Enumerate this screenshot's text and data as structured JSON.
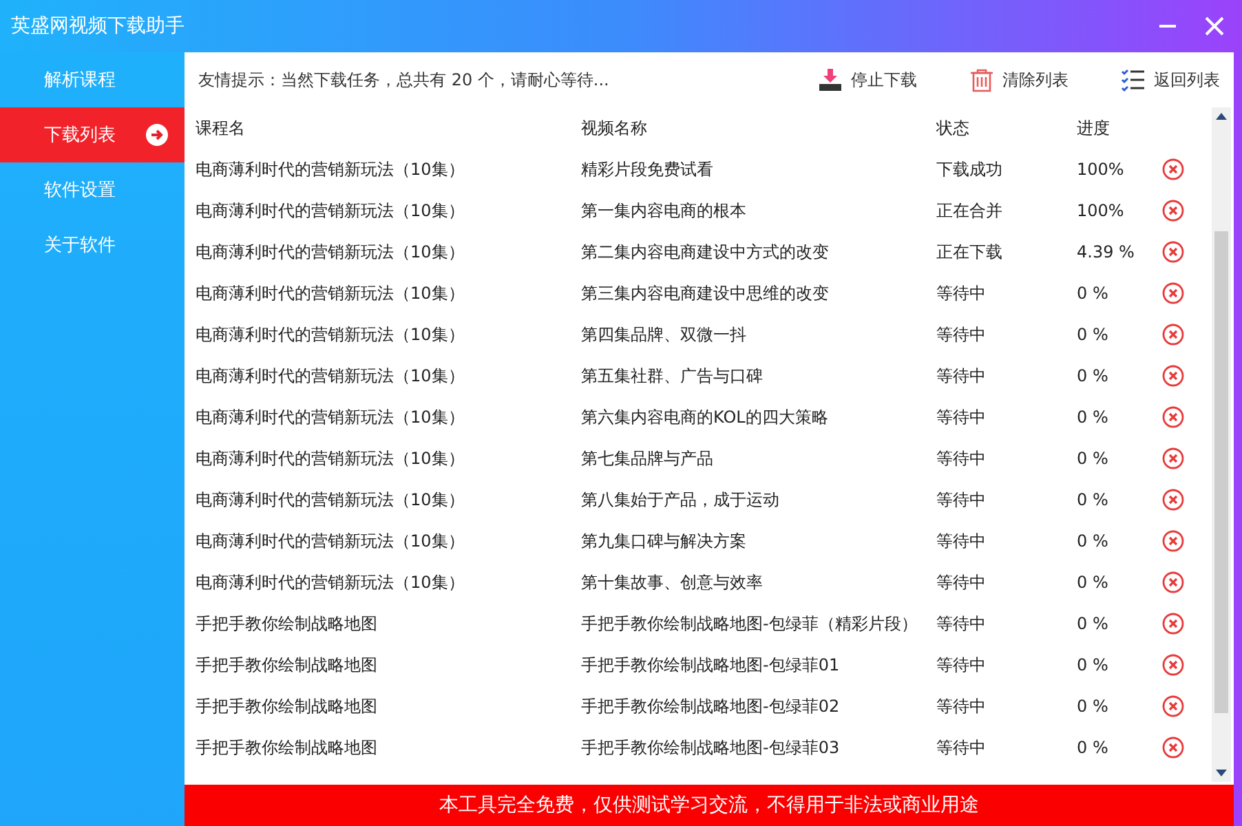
{
  "window": {
    "title": "英盛网视频下载助手"
  },
  "sidebar": {
    "items": [
      {
        "label": "解析课程",
        "selected": false
      },
      {
        "label": "下载列表",
        "selected": true
      },
      {
        "label": "软件设置",
        "selected": false
      },
      {
        "label": "关于软件",
        "selected": false
      }
    ]
  },
  "toolbar": {
    "hint": "友情提示：当然下载任务，总共有 20 个，请耐心等待...",
    "buttons": [
      {
        "kind": "download",
        "label": "停止下载"
      },
      {
        "kind": "trash",
        "label": "清除列表"
      },
      {
        "kind": "list",
        "label": "返回列表"
      }
    ]
  },
  "table": {
    "columns": [
      "课程名",
      "视频名称",
      "状态",
      "进度"
    ],
    "rows": [
      {
        "course": "电商薄利时代的营销新玩法（10集）",
        "video": "精彩片段免费试看",
        "status": "下载成功",
        "progress": "100%"
      },
      {
        "course": "电商薄利时代的营销新玩法（10集）",
        "video": "第一集内容电商的根本",
        "status": "正在合并",
        "progress": "100%"
      },
      {
        "course": "电商薄利时代的营销新玩法（10集）",
        "video": "第二集内容电商建设中方式的改变",
        "status": "正在下载",
        "progress": "4.39 %"
      },
      {
        "course": "电商薄利时代的营销新玩法（10集）",
        "video": "第三集内容电商建设中思维的改变",
        "status": "等待中",
        "progress": "0 %"
      },
      {
        "course": "电商薄利时代的营销新玩法（10集）",
        "video": "第四集品牌、双微一抖",
        "status": "等待中",
        "progress": "0 %"
      },
      {
        "course": "电商薄利时代的营销新玩法（10集）",
        "video": "第五集社群、广告与口碑",
        "status": "等待中",
        "progress": "0 %"
      },
      {
        "course": "电商薄利时代的营销新玩法（10集）",
        "video": "第六集内容电商的KOL的四大策略",
        "status": "等待中",
        "progress": "0 %"
      },
      {
        "course": "电商薄利时代的营销新玩法（10集）",
        "video": "第七集品牌与产品",
        "status": "等待中",
        "progress": "0 %"
      },
      {
        "course": "电商薄利时代的营销新玩法（10集）",
        "video": "第八集始于产品，成于运动",
        "status": "等待中",
        "progress": "0 %"
      },
      {
        "course": "电商薄利时代的营销新玩法（10集）",
        "video": "第九集口碑与解决方案",
        "status": "等待中",
        "progress": "0 %"
      },
      {
        "course": "电商薄利时代的营销新玩法（10集）",
        "video": "第十集故事、创意与效率",
        "status": "等待中",
        "progress": "0 %"
      },
      {
        "course": "手把手教你绘制战略地图",
        "video": "手把手教你绘制战略地图-包绿菲（精彩片段）",
        "status": "等待中",
        "progress": "0 %"
      },
      {
        "course": "手把手教你绘制战略地图",
        "video": "手把手教你绘制战略地图-包绿菲01",
        "status": "等待中",
        "progress": "0 %"
      },
      {
        "course": "手把手教你绘制战略地图",
        "video": "手把手教你绘制战略地图-包绿菲02",
        "status": "等待中",
        "progress": "0 %"
      },
      {
        "course": "手把手教你绘制战略地图",
        "video": "手把手教你绘制战略地图-包绿菲03",
        "status": "等待中",
        "progress": "0 %"
      }
    ]
  },
  "footer": "本工具完全免费，仅供测试学习交流，不得用于非法或商业用途"
}
